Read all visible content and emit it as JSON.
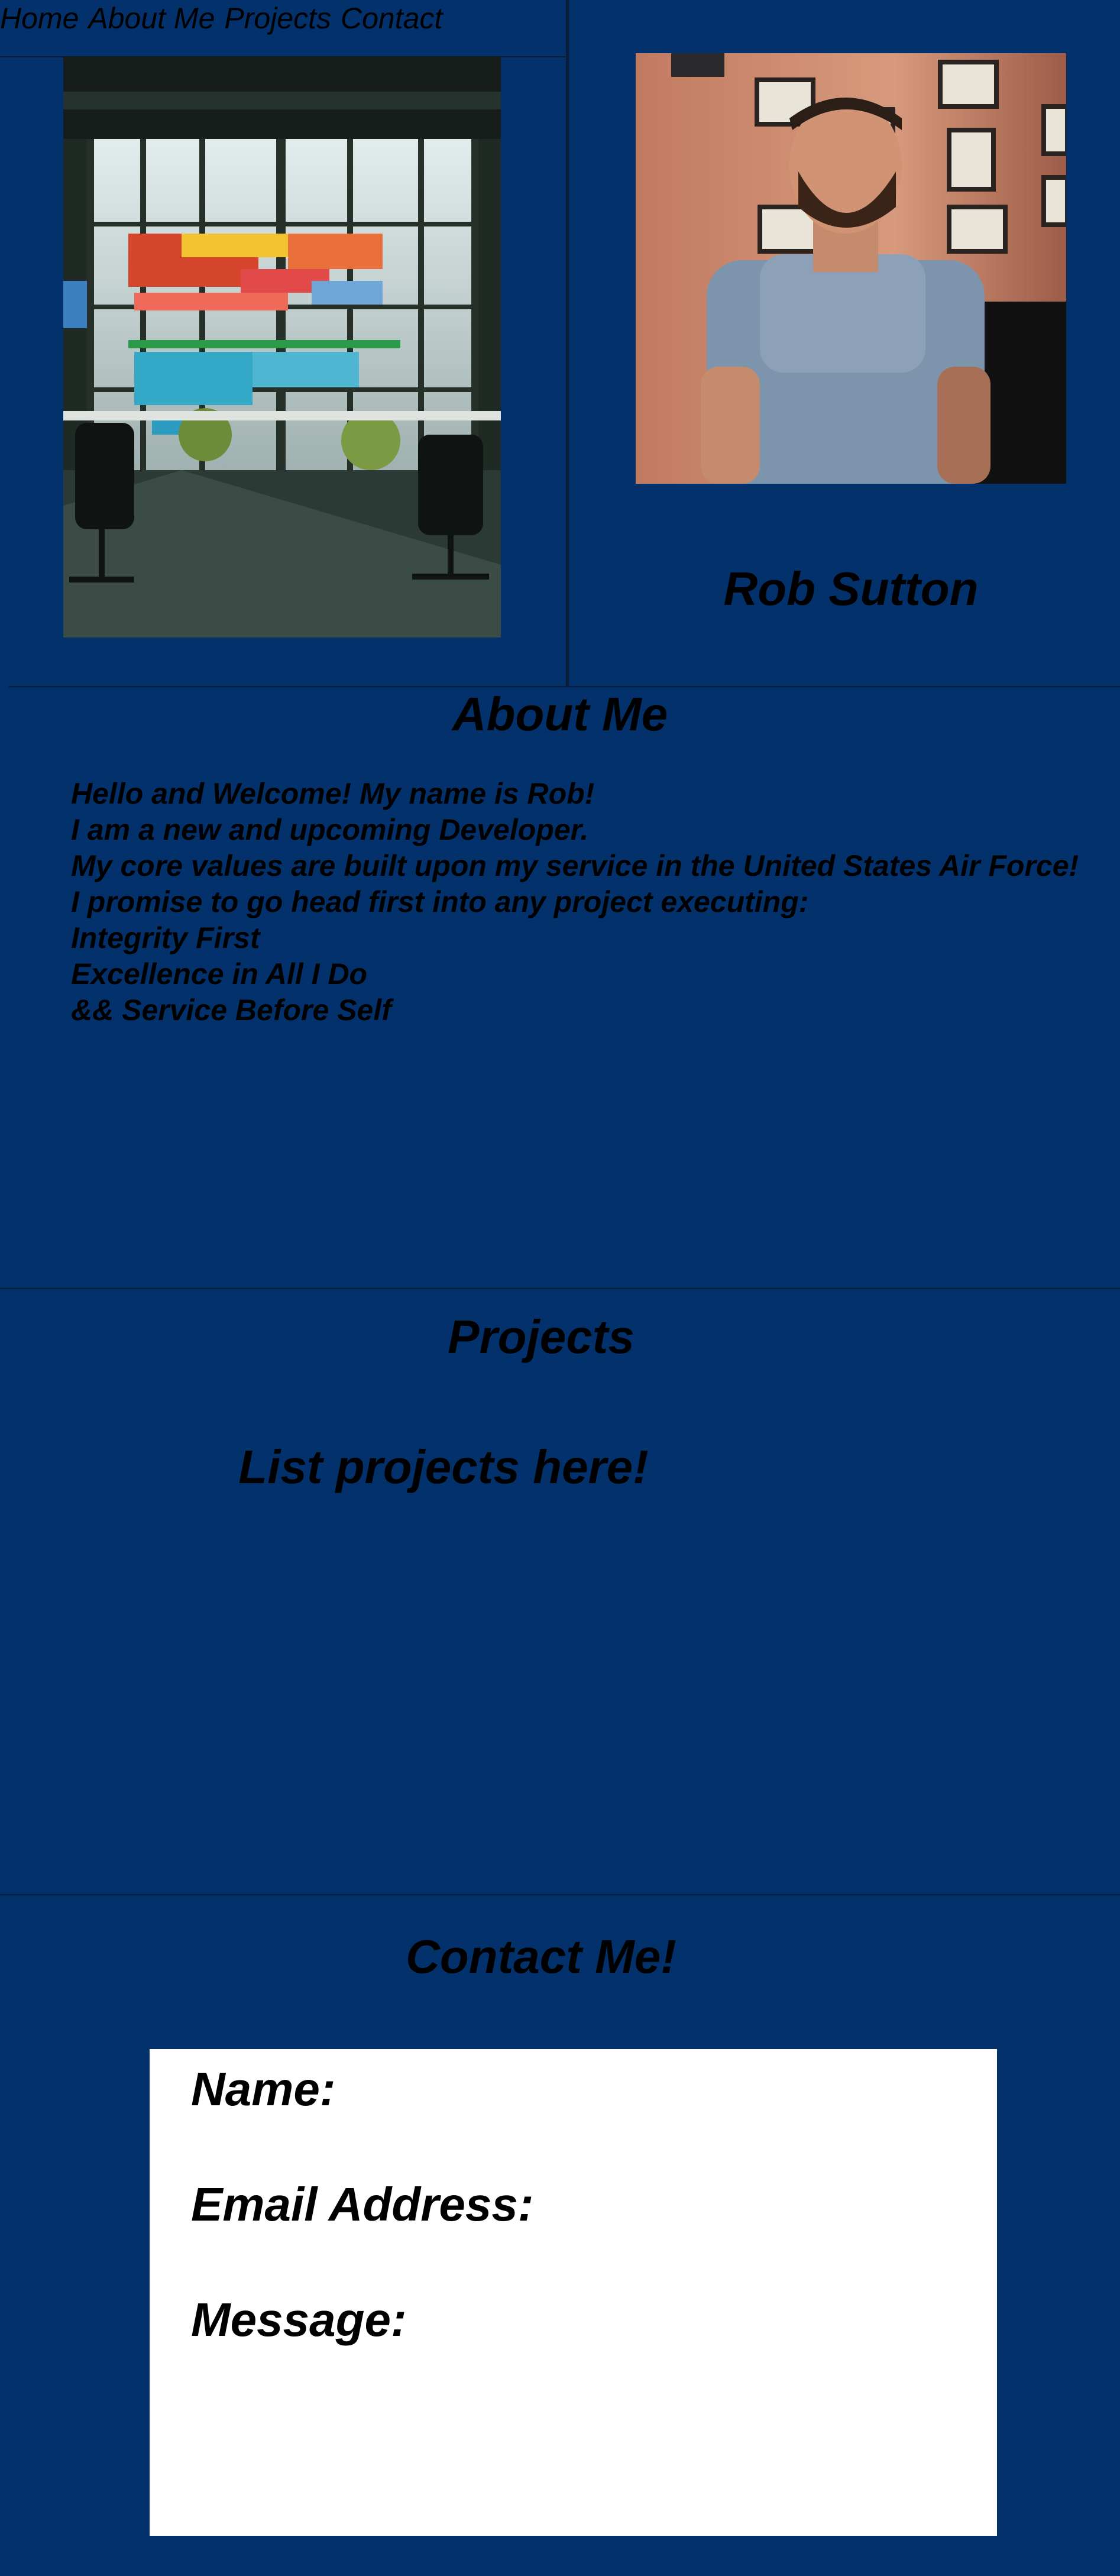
{
  "nav": {
    "items": [
      {
        "label": "Home"
      },
      {
        "label": "About Me"
      },
      {
        "label": "Projects"
      },
      {
        "label": "Contact"
      }
    ]
  },
  "profile": {
    "name": "Rob Sutton"
  },
  "about": {
    "title": "About Me",
    "lines": [
      "Hello and Welcome! My name is Rob!",
      "I am a new and upcoming Developer.",
      "My core values are built upon my service in the United States Air Force!",
      "I promise to go head first into any project executing:",
      "Integrity First",
      "Excellence in All I Do",
      "&& Service Before Self"
    ]
  },
  "projects": {
    "title": "Projects",
    "placeholder": "List projects here!"
  },
  "contact": {
    "title": "Contact Me!",
    "name_label": "Name:",
    "email_label": "Email Address:",
    "message_label": "Message:"
  },
  "colors": {
    "background": "#02316c",
    "form_background": "#ffffff",
    "text": "#000000"
  }
}
